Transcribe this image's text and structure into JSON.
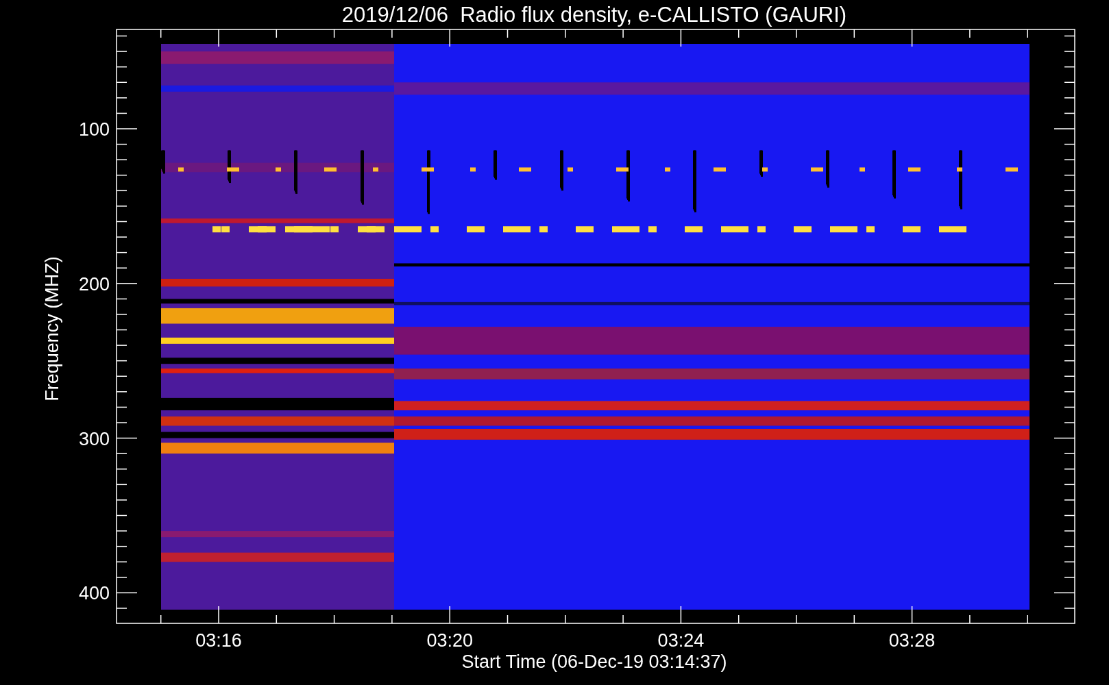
{
  "title": "2019/12/06  Radio flux density, e-CALLISTO (GAURI)",
  "y_axis": {
    "label": "Frequency (MHZ)",
    "tick_labels": [
      "100",
      "200",
      "300",
      "400"
    ]
  },
  "x_axis": {
    "label": "Start Time (06-Dec-19 03:14:37)",
    "tick_labels": [
      "03:16",
      "03:20",
      "03:24",
      "03:28"
    ]
  }
}
